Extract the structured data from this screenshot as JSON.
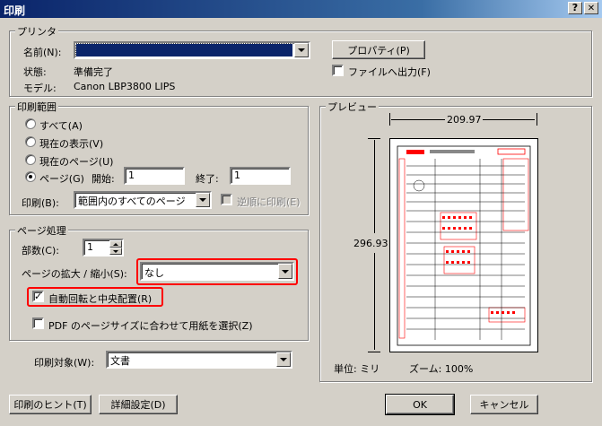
{
  "window": {
    "title": "印刷",
    "help_btn": "?",
    "close_btn": "X"
  },
  "printer": {
    "group_label": "プリンタ",
    "name_label": "名前(N):",
    "name_value": "",
    "properties_button": "プロパティ(P)",
    "print_to_file": "ファイルへ出力(F)",
    "status_label": "状態:",
    "status_value": "準備完了",
    "model_label": "モデル:",
    "model_value": "Canon LBP3800 LIPS"
  },
  "range": {
    "group_label": "印刷範囲",
    "all": "すべて(A)",
    "current_view": "現在の表示(V)",
    "current_page": "現在のページ(U)",
    "pages": "ページ(G)",
    "start_label": "開始:",
    "start_value": "1",
    "end_label": "終了:",
    "end_value": "1",
    "print_label": "印刷(B):",
    "print_value": "範囲内のすべてのページ",
    "reverse": "逆順に印刷(E)"
  },
  "handling": {
    "group_label": "ページ処理",
    "copies_label": "部数(C):",
    "copies_value": "1",
    "scaling_label": "ページの拡大 / 縮小(S):",
    "scaling_value": "なし",
    "auto_rotate": "自動回転と中央配置(R)",
    "pdf_size": "PDF のページサイズに合わせて用紙を選択(Z)"
  },
  "print_what": {
    "label": "印刷対象(W):",
    "value": "文書"
  },
  "preview": {
    "group_label": "プレビュー",
    "width": "209.97",
    "height": "296.93",
    "unit": "単位: ミリ",
    "zoom": "ズーム: 100%"
  },
  "buttons": {
    "hints": "印刷のヒント(T)",
    "advanced": "詳細設定(D)",
    "ok": "OK",
    "cancel": "キャンセル"
  },
  "colors": {
    "highlight": "#ff0000",
    "selection": "#0a246a"
  }
}
